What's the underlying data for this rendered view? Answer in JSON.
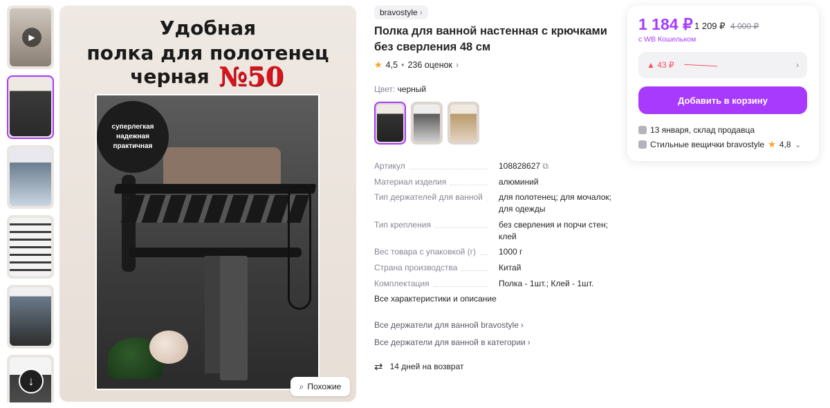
{
  "gallery": {
    "scroll_icon": "arrow-down-icon",
    "similar_label": "Похожие",
    "poster": {
      "line1": "Удобная",
      "line2": "полка для полотенец",
      "line3": "черная",
      "number": "№50",
      "badge": [
        "суперлегкая",
        "надежная",
        "практичная"
      ]
    }
  },
  "product": {
    "brand": "bravostyle",
    "title": "Полка для ванной настенная с крючками без сверления 48 см",
    "rating": "4,5",
    "reviews": "236 оценок",
    "color_label": "Цвет:",
    "color_value": "черный"
  },
  "specs": [
    {
      "key": "Артикул",
      "value": "108828627"
    },
    {
      "key": "Материал изделия",
      "value": "алюминий"
    },
    {
      "key": "Тип держателей для ванной",
      "value": "для полотенец; для мочалок; для одежды"
    },
    {
      "key": "Тип крепления",
      "value": "без сверления и порчи стен; клей"
    },
    {
      "key": "Вес товара с упаковкой (г)",
      "value": "1000 г"
    },
    {
      "key": "Страна производства",
      "value": "Китай"
    },
    {
      "key": "Комплектация",
      "value": "Полка - 1шт.; Клей - 1шт."
    }
  ],
  "links": {
    "all_specs": "Все характеристики и описание",
    "brand_holders": "Все держатели для ванной bravostyle",
    "category_holders": "Все держатели для ванной в категории",
    "return": "14 дней на возврат"
  },
  "price": {
    "current": "1 184 ₽",
    "mid": "1 209 ₽",
    "old": "4 000 ₽",
    "wallet_note": "с WB Кошельком",
    "drop": "▲ 43 ₽",
    "add_to_cart": "Добавить в корзину",
    "delivery": "13 января, склад продавца",
    "seller": "Стильные вещички bravostyle",
    "seller_rating": "4,8"
  },
  "colors": {
    "accent": "#a73afd",
    "star": "#ff9f1a",
    "drop": "#f5515f"
  }
}
